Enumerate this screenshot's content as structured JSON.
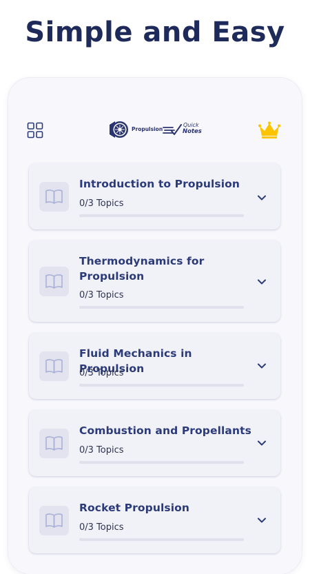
{
  "headline": "Simple and Easy",
  "header": {
    "logo": {
      "word": "Propulsion",
      "quick": "Quick",
      "notes": "Notes"
    },
    "menu_icon": "grid-icon",
    "premium_icon": "crown-icon",
    "colors": {
      "brand": "#2b3a78",
      "crown": "#fcc400",
      "headline": "#1e2a5a"
    }
  },
  "chapters": [
    {
      "title": "Introduction to Propulsion",
      "topics": "0/3 Topics",
      "progress": 0
    },
    {
      "title": "Thermodynamics for Propulsion",
      "topics": "0/3 Topics",
      "progress": 0
    },
    {
      "title": "Fluid Mechanics in Propulsion",
      "topics": "0/3 Topics",
      "progress": 0
    },
    {
      "title": "Combustion and Propellants",
      "topics": "0/3 Topics",
      "progress": 0
    },
    {
      "title": "Rocket Propulsion",
      "topics": "0/3 Topics",
      "progress": 0
    }
  ]
}
